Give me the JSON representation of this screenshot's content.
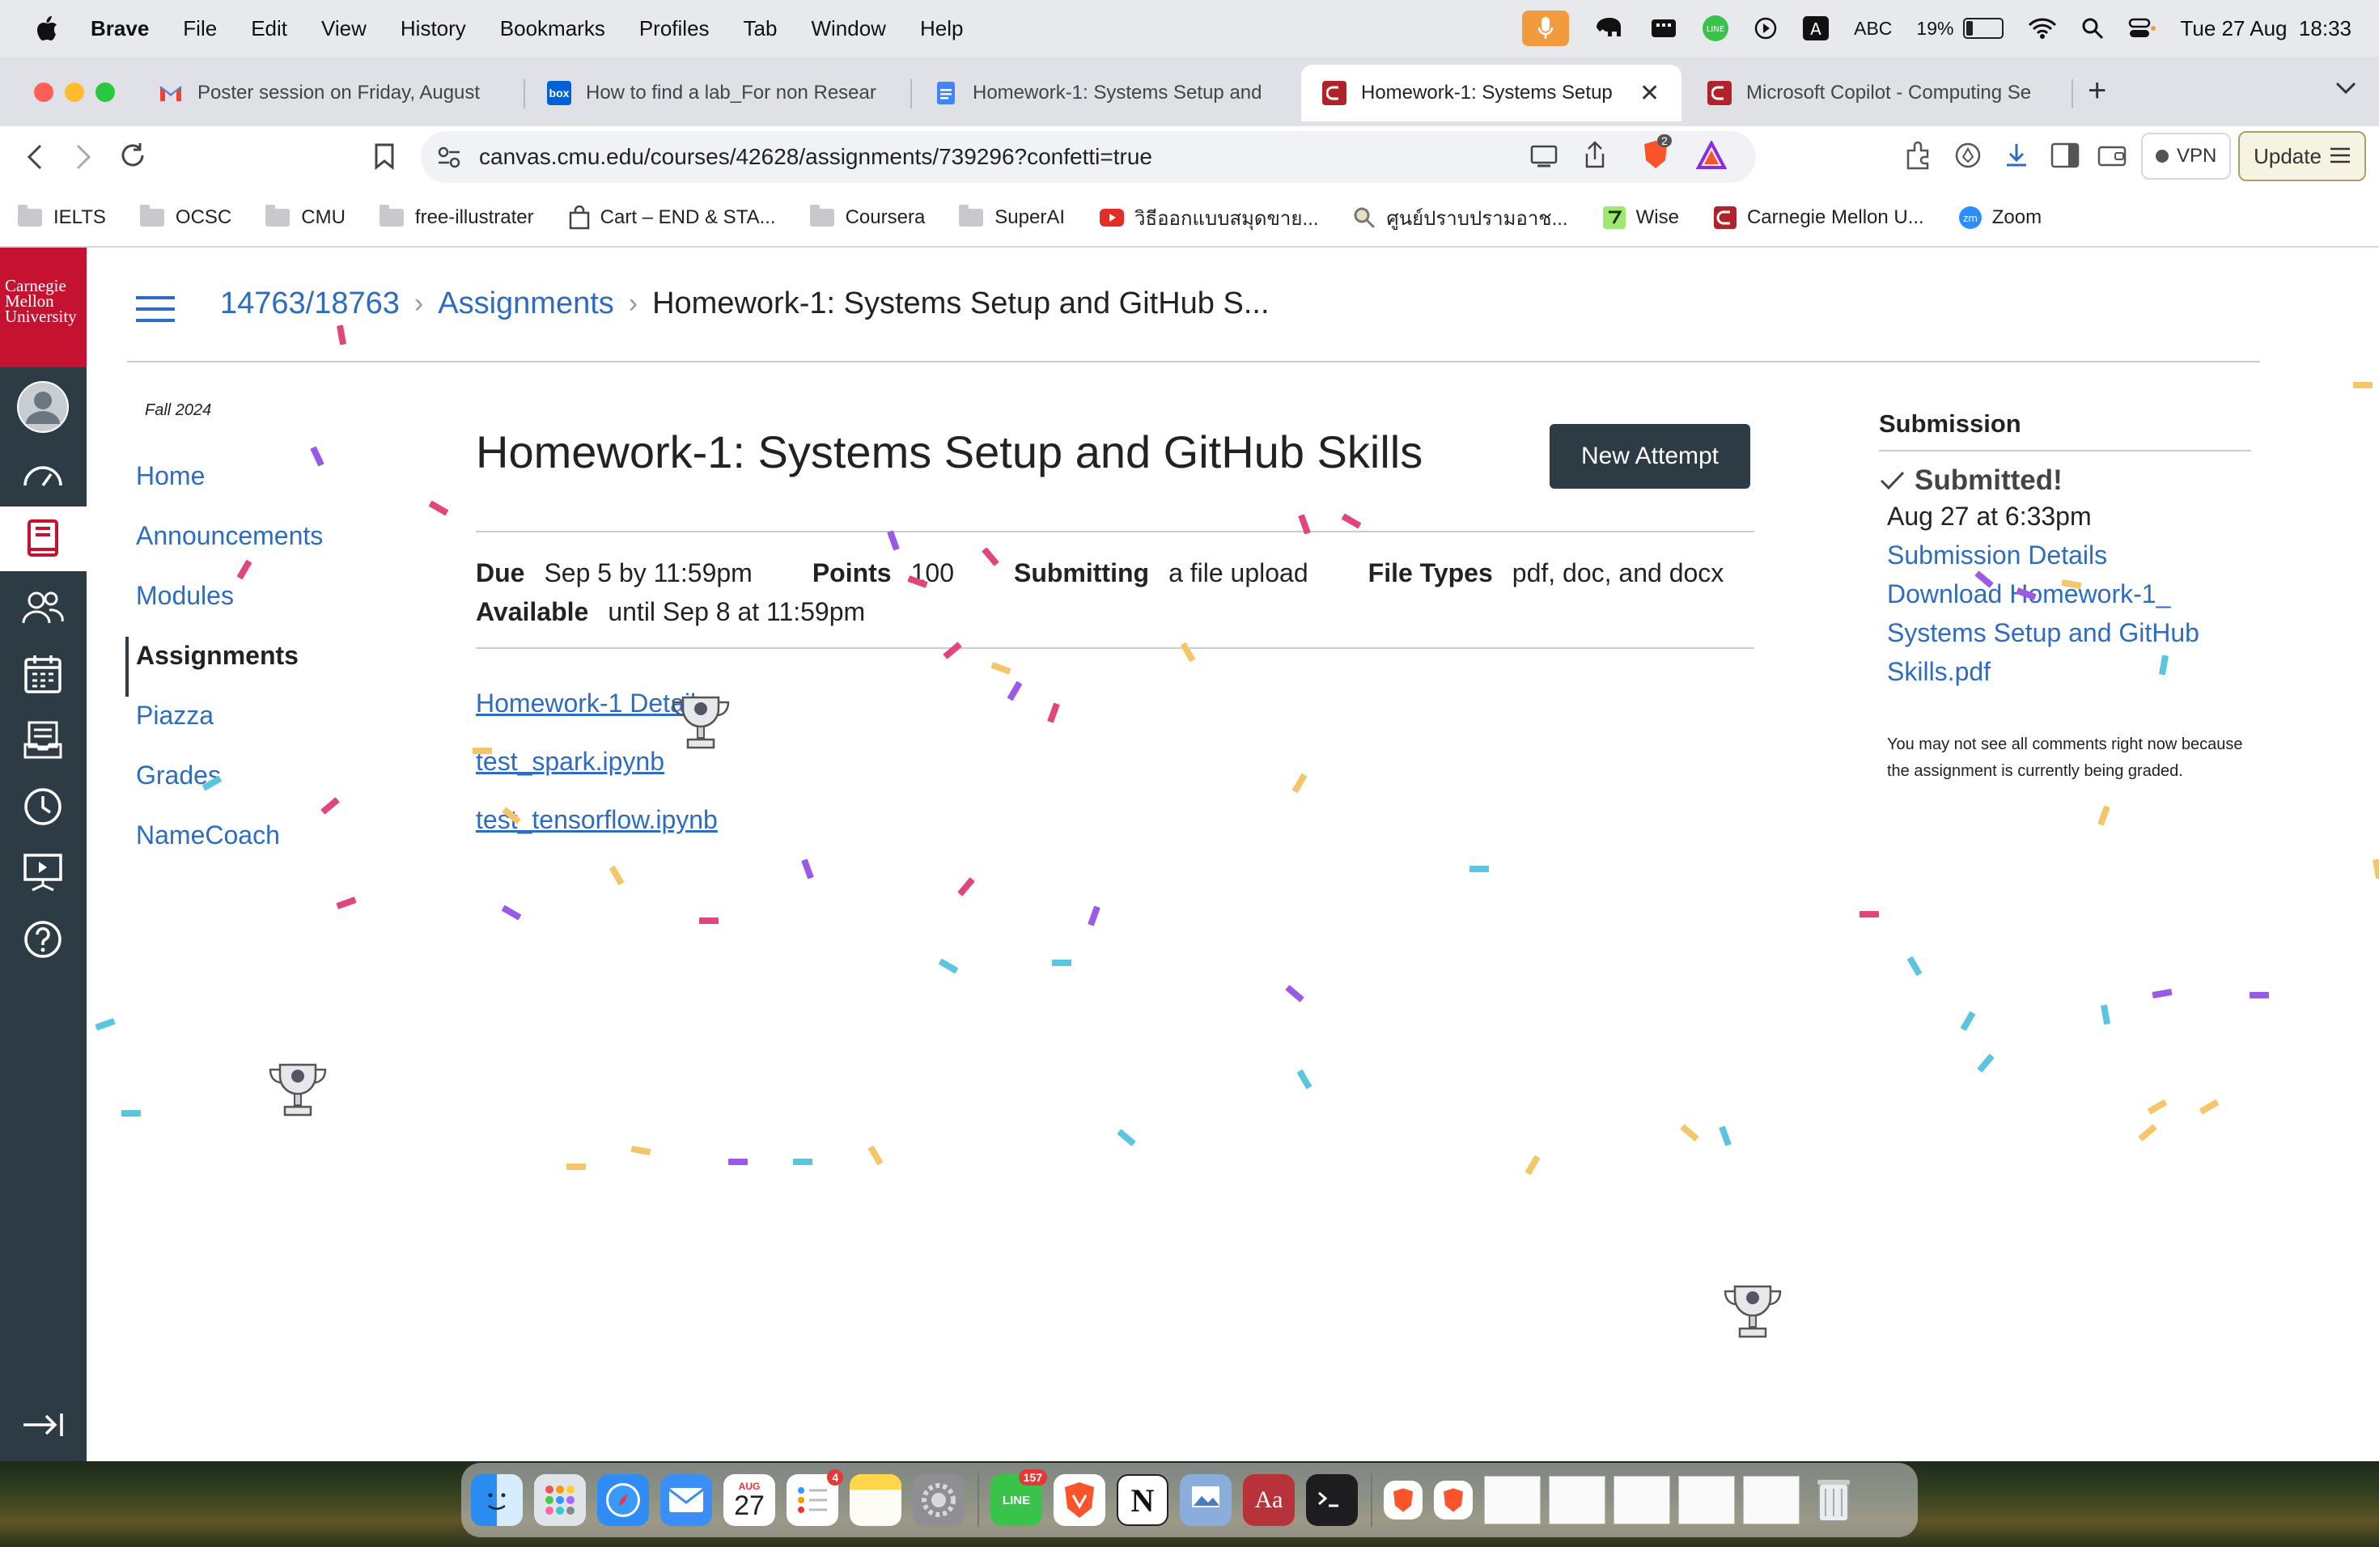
{
  "menubar": {
    "app": "Brave",
    "items": [
      "File",
      "Edit",
      "View",
      "History",
      "Bookmarks",
      "Profiles",
      "Tab",
      "Window",
      "Help"
    ],
    "input_source": "ABC",
    "battery": "19%",
    "battery_level": 0.19,
    "datetime": "Tue 27 Aug  18:33"
  },
  "tabs": [
    {
      "label": "Poster session on Friday, August",
      "icon": "gmail-icon",
      "color": "#ffffff"
    },
    {
      "label": "How to find a lab_For non Resear",
      "icon": "box-icon",
      "color": "#0061d5"
    },
    {
      "label": "Homework-1: Systems Setup and",
      "icon": "docs-icon",
      "color": "#4285f4"
    },
    {
      "label": "Homework-1: Systems Setup",
      "icon": "canvas-icon",
      "color": "#b1232a"
    },
    {
      "label": "Microsoft Copilot - Computing Se",
      "icon": "canvas-icon",
      "color": "#b1232a"
    }
  ],
  "toolbar": {
    "url": "canvas.cmu.edu/courses/42628/assignments/739296?confetti=true",
    "shields_count": "2",
    "vpn_label": "VPN",
    "update_label": "Update"
  },
  "bookmarks": [
    {
      "label": "IELTS",
      "icon": "folder-icon"
    },
    {
      "label": "OCSC",
      "icon": "folder-icon"
    },
    {
      "label": "CMU",
      "icon": "folder-icon"
    },
    {
      "label": "free-illustrater",
      "icon": "folder-icon"
    },
    {
      "label": "Cart – END & STA...",
      "icon": "shopping-bag-icon"
    },
    {
      "label": "Coursera",
      "icon": "folder-icon"
    },
    {
      "label": "SuperAI",
      "icon": "folder-icon"
    },
    {
      "label": "วิธีออกแบบสมุดขาย...",
      "icon": "youtube-icon"
    },
    {
      "label": "ศูนย์ปราบปรามอาช...",
      "icon": "magnifier-icon"
    },
    {
      "label": "Wise",
      "icon": "wise-icon"
    },
    {
      "label": "Carnegie Mellon U...",
      "icon": "canvas-icon"
    },
    {
      "label": "Zoom",
      "icon": "zoom-icon"
    }
  ],
  "logo": {
    "line1": "Carnegie",
    "line2": "Mellon",
    "line3": "University"
  },
  "breadcrumb": {
    "course": "14763/18763",
    "section": "Assignments",
    "current": "Homework-1: Systems Setup and GitHub S..."
  },
  "course_nav": {
    "term": "Fall 2024",
    "items": [
      "Home",
      "Announcements",
      "Modules",
      "Assignments",
      "Piazza",
      "Grades",
      "NameCoach"
    ],
    "active": "Assignments"
  },
  "assignment": {
    "title": "Homework-1: Systems Setup and GitHub Skills",
    "new_attempt": "New Attempt",
    "due_label": "Due",
    "due": "Sep 5 by 11:59pm",
    "points_label": "Points",
    "points": "100",
    "submitting_label": "Submitting",
    "submitting": "a file upload",
    "file_types_label": "File Types",
    "file_types": "pdf, doc, and docx",
    "available_label": "Available",
    "available": "until Sep 8 at 11:59pm",
    "files": [
      "Homework-1 Details",
      "test_spark.ipynb",
      "test_tensorflow.ipynb"
    ]
  },
  "submission": {
    "heading": "Submission",
    "status": "Submitted!",
    "time": "Aug 27 at 6:33pm",
    "details_link": "Submission Details",
    "download_line1": "Download Homework-1_",
    "download_line2": "Systems Setup and GitHub",
    "download_line3": "Skills.pdf",
    "note": "You may not see all comments right now because the assignment is currently being graded."
  },
  "dock": {
    "calendar_month": "AUG",
    "calendar_day": "27",
    "reminders_badge": "4",
    "line_badge": "157",
    "dictionary_label": "Aa"
  },
  "colors": {
    "canvas_nav": "#2d3b45",
    "cmu_red": "#c41230",
    "link": "#2d6cc0",
    "confetti": [
      "#e0457b",
      "#9b59e8",
      "#5bc5e0",
      "#f5c56a"
    ]
  }
}
